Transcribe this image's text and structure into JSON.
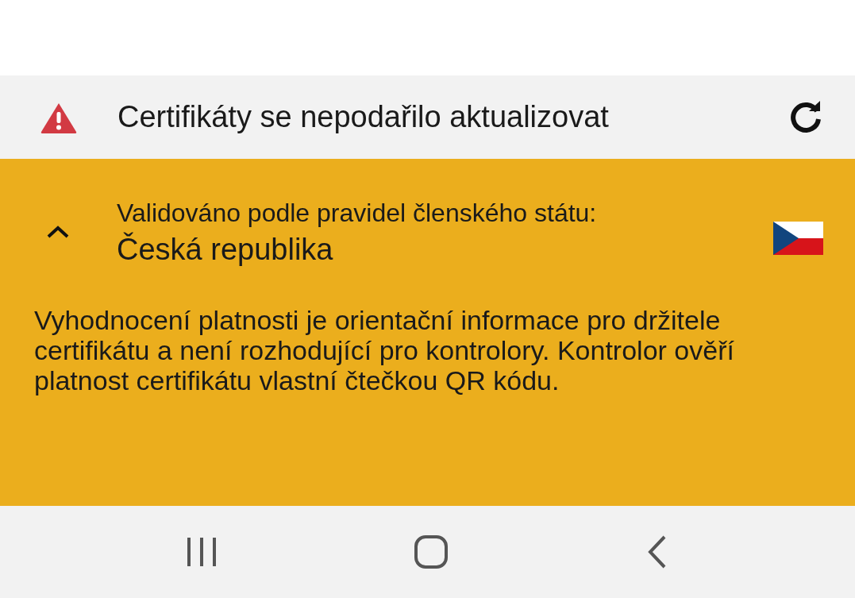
{
  "sync_banner": {
    "message": "Certifikáty se nepodařilo aktualizovat"
  },
  "validation_panel": {
    "expanded": true,
    "label": "Validováno podle pravidel členského státu:",
    "country": "Česká republika",
    "note": "Vyhodnocení platnosti je orientační informace pro držitele certifikátu a není rozhodující pro kontrolory. Kontrolor ověří platnost certifikátu vlastní čtečkou QR kódu."
  }
}
